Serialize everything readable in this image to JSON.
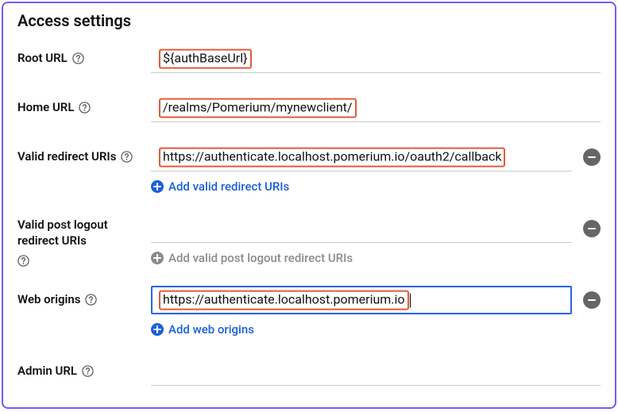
{
  "section_title": "Access settings",
  "fields": {
    "root_url": {
      "label": "Root URL",
      "value": "${authBaseUrl}"
    },
    "home_url": {
      "label": "Home URL",
      "value": "/realms/Pomerium/mynewclient/"
    },
    "redirect": {
      "label": "Valid redirect URIs",
      "value": "https://authenticate.localhost.pomerium.io/oauth2/callback",
      "add_label": "Add valid redirect URIs"
    },
    "post_logout": {
      "label": "Valid post logout redirect URIs",
      "value": "",
      "add_label": "Add valid post logout redirect URIs"
    },
    "web_origins": {
      "label": "Web origins",
      "value": "https://authenticate.localhost.pomerium.io",
      "add_label": "Add web origins"
    },
    "admin_url": {
      "label": "Admin URL",
      "value": ""
    }
  }
}
